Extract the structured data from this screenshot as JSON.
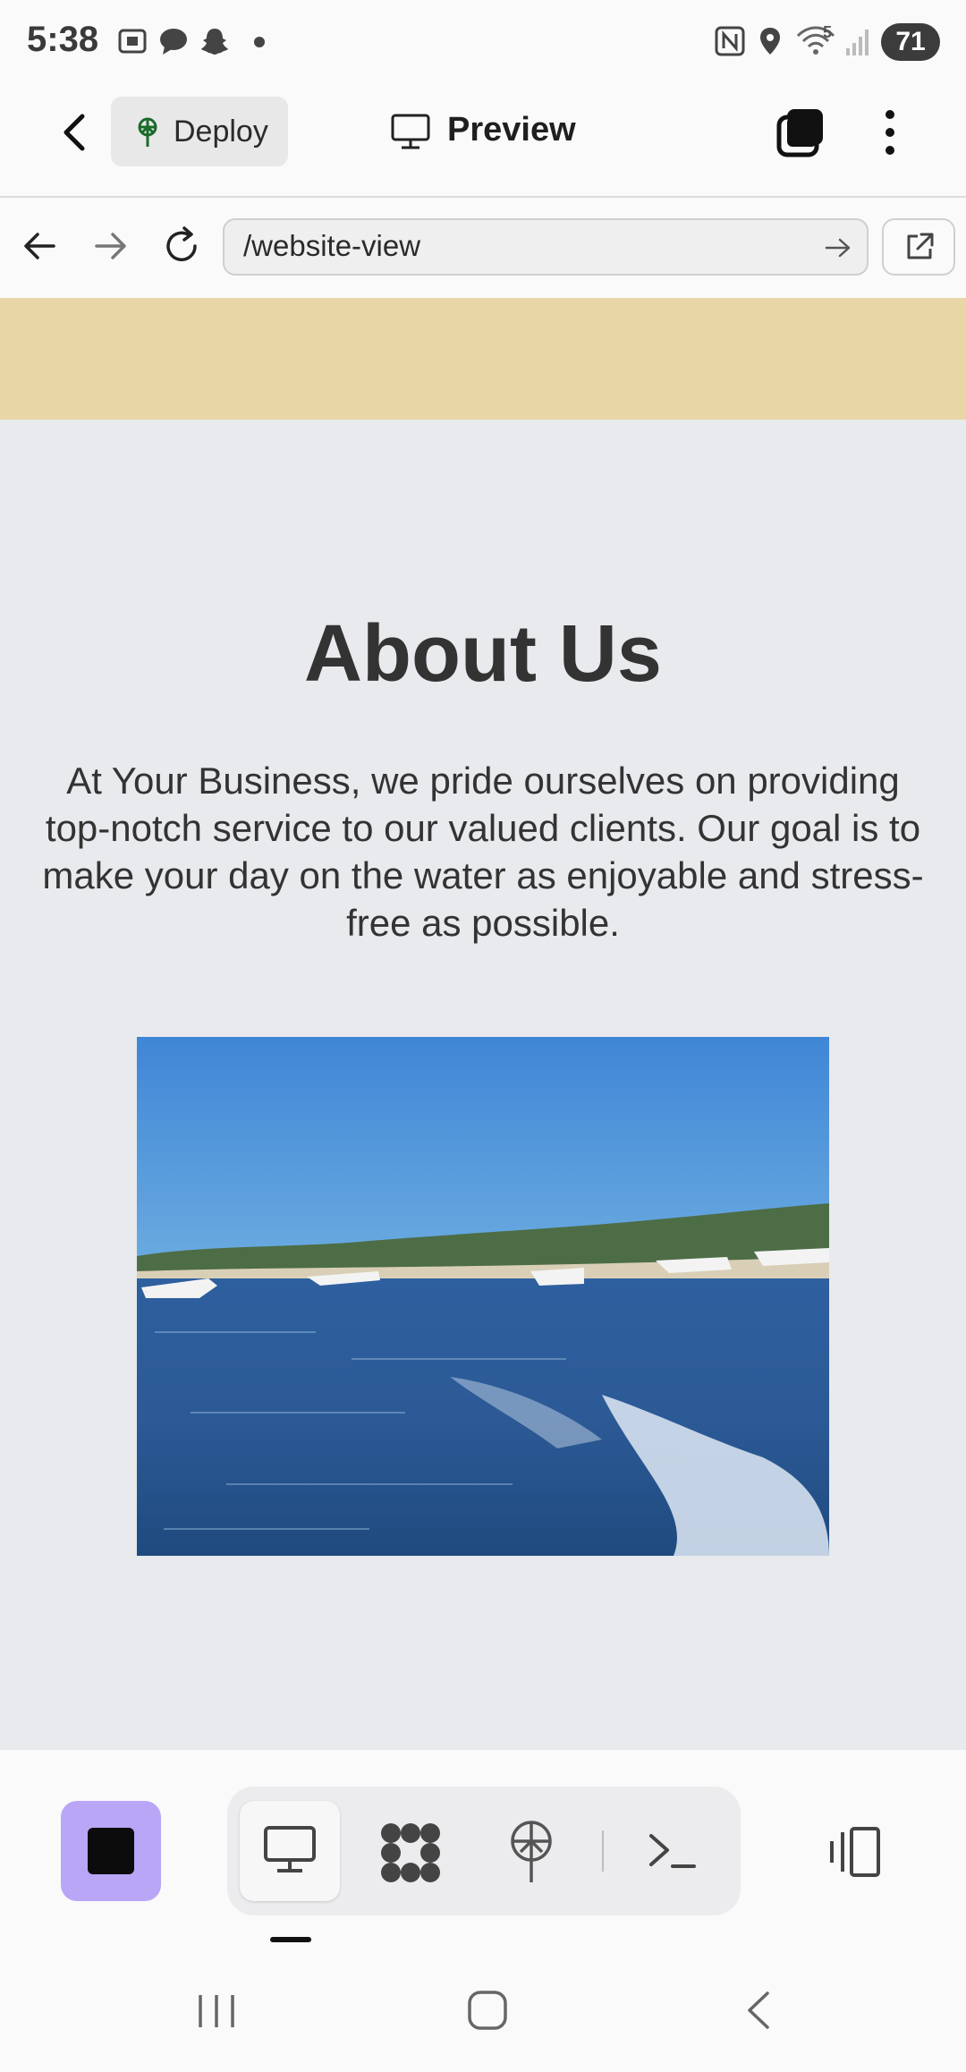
{
  "status_bar": {
    "time": "5:38",
    "battery": "71",
    "network_label": "5",
    "icons": [
      "screenshot-icon",
      "chat-bubble-icon",
      "snapchat-icon",
      "dot-icon",
      "nfc-icon",
      "location-icon",
      "wifi-icon",
      "signal-icon"
    ]
  },
  "top_bar": {
    "deploy_label": "Deploy",
    "preview_label": "Preview",
    "icons": [
      "back-chevron-icon",
      "deploy-icon",
      "monitor-icon",
      "tabs-icon",
      "kebab-menu-icon"
    ]
  },
  "url_bar": {
    "url": "/website-view",
    "icons": [
      "back-arrow-icon",
      "forward-arrow-icon",
      "reload-icon",
      "go-arrow-icon",
      "open-external-icon"
    ]
  },
  "website": {
    "heading": "About Us",
    "paragraph": "At Your Business, we pride ourselves on providing top-notch service to our valued clients. Our goal is to make your day on the water as enjoyable and stress-free as possible.",
    "colors": {
      "banner": "#e8d6a6",
      "background": "#e9eaed",
      "text": "#333333"
    }
  },
  "bottom_toolbar": {
    "icons": [
      "stop-icon",
      "desktop-icon",
      "grid-icon",
      "deploy-icon",
      "terminal-icon",
      "panel-toggle-icon"
    ],
    "accent": "#b9a6f7"
  },
  "nav_bar": {
    "icons": [
      "recents-icon",
      "home-icon",
      "back-icon"
    ]
  }
}
